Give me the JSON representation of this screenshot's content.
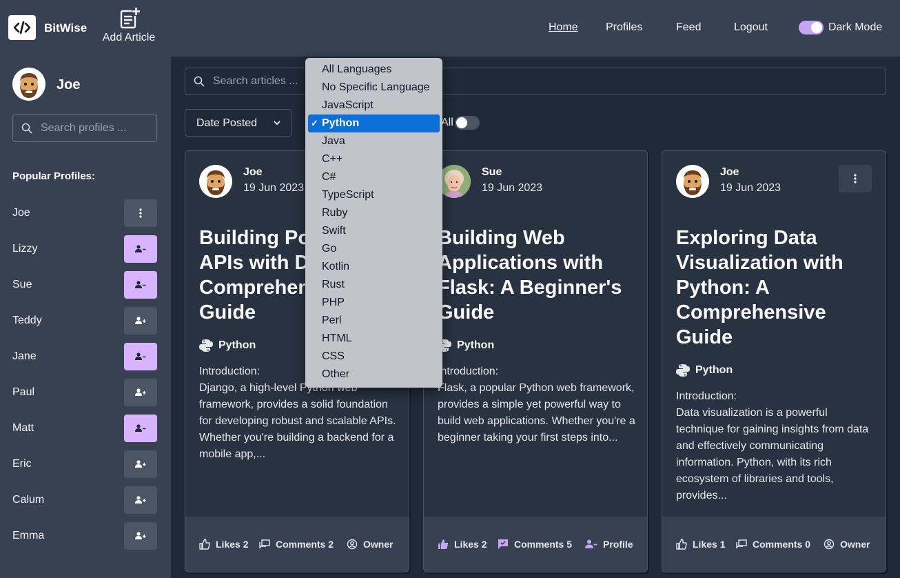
{
  "navbar": {
    "brand": "BitWise",
    "add_article": "Add Article",
    "links": {
      "home": "Home",
      "profiles": "Profiles",
      "feed": "Feed",
      "logout": "Logout"
    },
    "dark_mode_label": "Dark Mode",
    "dark_mode_on": true
  },
  "sidebar": {
    "user_name": "Joe",
    "search_placeholder": "Search profiles ...",
    "popular_title": "Popular Profiles:",
    "profiles": [
      {
        "name": "Joe",
        "action": "menu"
      },
      {
        "name": "Lizzy",
        "action": "unfollow"
      },
      {
        "name": "Sue",
        "action": "unfollow"
      },
      {
        "name": "Teddy",
        "action": "follow"
      },
      {
        "name": "Jane",
        "action": "unfollow"
      },
      {
        "name": "Paul",
        "action": "follow"
      },
      {
        "name": "Matt",
        "action": "unfollow"
      },
      {
        "name": "Eric",
        "action": "follow"
      },
      {
        "name": "Calum",
        "action": "follow"
      },
      {
        "name": "Emma",
        "action": "follow"
      }
    ]
  },
  "main": {
    "search_placeholder": "Search articles ...",
    "sort_value": "Date Posted",
    "all_label": "All",
    "language_dropdown": {
      "options": [
        "All Languages",
        "No Specific Language",
        "JavaScript",
        "Python",
        "Java",
        "C++",
        "C#",
        "TypeScript",
        "Ruby",
        "Swift",
        "Go",
        "Kotlin",
        "Rust",
        "PHP",
        "Perl",
        "HTML",
        "CSS",
        "Other"
      ],
      "selected": "Python",
      "check": "✓"
    },
    "articles": [
      {
        "author": "Joe",
        "date": "19 Jun 2023",
        "title": "Building Powerful APIs with Django: A Comprehensive Guide",
        "language": "Python",
        "excerpt": "Introduction:\nDjango, a high-level Python web framework, provides a solid foundation for developing robust and scalable APIs. Whether you're building a backend for a mobile app,...",
        "likes": "Likes 2",
        "comments": "Comments 2",
        "third": "Owner"
      },
      {
        "author": "Sue",
        "date": "19 Jun 2023",
        "title": "Building Web Applications with Flask: A Beginner's Guide",
        "language": "Python",
        "excerpt": "Introduction:\nFlask, a popular Python web framework, provides a simple yet powerful way to build web applications. Whether you're a beginner taking your first steps into...",
        "likes": "Likes 2",
        "comments": "Comments 5",
        "third": "Profile"
      },
      {
        "author": "Joe",
        "date": "19 Jun 2023",
        "title": "Exploring Data Visualization with Python: A Comprehensive Guide",
        "language": "Python",
        "excerpt": "Introduction:\nData visualization is a powerful technique for gaining insights from data and effectively communicating information. Python, with its rich ecosystem of libraries and tools, provides...",
        "likes": "Likes 1",
        "comments": "Comments 0",
        "third": "Owner"
      }
    ]
  }
}
